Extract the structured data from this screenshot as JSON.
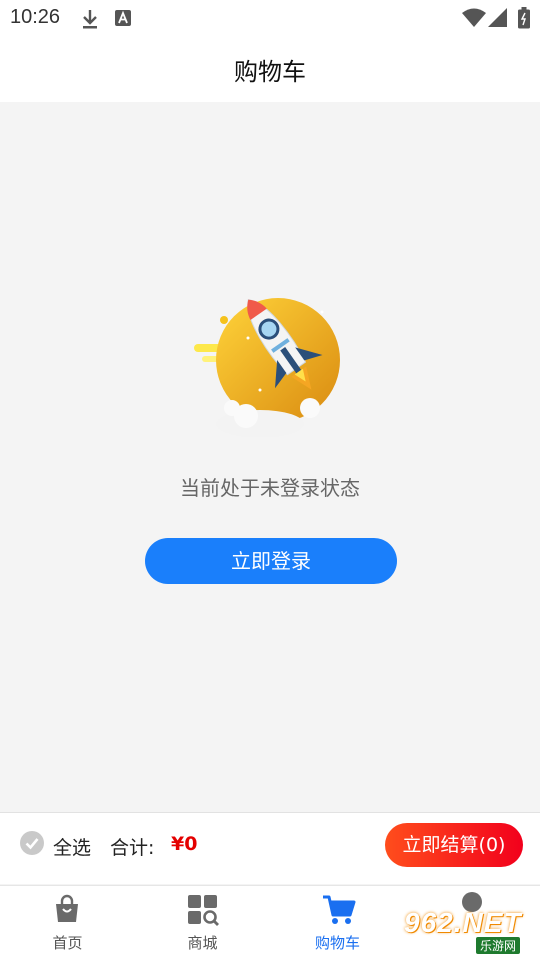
{
  "status_bar": {
    "time": "10:26",
    "icons": [
      "download-icon",
      "text-notification-icon",
      "wifi-icon",
      "signal-icon",
      "battery-icon"
    ]
  },
  "header": {
    "title": "购物车"
  },
  "empty_state": {
    "illustration": "rocket-illustration",
    "message": "当前处于未登录状态",
    "login_label": "立即登录"
  },
  "cart_bar": {
    "select_all_label": "全选",
    "total_label": "合计:",
    "total_amount": "¥0",
    "checkout_label": "立即结算(0)",
    "accent_color": "#f2001c"
  },
  "tabs": [
    {
      "label": "首页",
      "icon": "shopping-bag-icon",
      "active": false
    },
    {
      "label": "商城",
      "icon": "grid-search-icon",
      "active": false
    },
    {
      "label": "购物车",
      "icon": "cart-icon",
      "active": true
    },
    {
      "label": "",
      "icon": "user-icon",
      "active": false
    }
  ],
  "watermark": {
    "brand": "962.NET",
    "sub": "乐游网"
  },
  "colors": {
    "primary": "#1a7ffb",
    "price": "#e40000",
    "tab_active": "#1a6ff0"
  }
}
